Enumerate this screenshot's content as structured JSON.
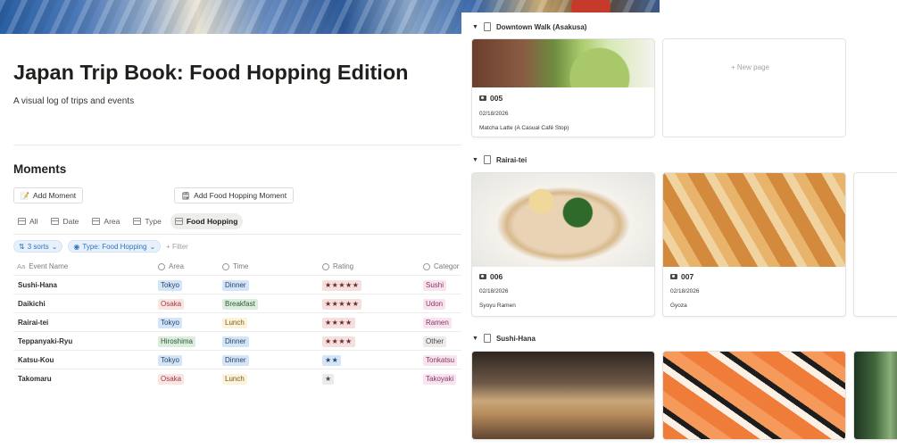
{
  "page": {
    "title": "Japan Trip Book: Food Hopping Edition",
    "description": "A visual log of trips and events",
    "section_title": "Moments"
  },
  "buttons": {
    "add_moment": "Add Moment",
    "add_food_moment": "Add Food Hopping Moment"
  },
  "tabs": [
    {
      "label": "All",
      "active": false
    },
    {
      "label": "Date",
      "active": false
    },
    {
      "label": "Area",
      "active": false
    },
    {
      "label": "Type",
      "active": false
    },
    {
      "label": "Food Hopping",
      "active": true
    }
  ],
  "filters": {
    "sorts": "3 sorts",
    "type_filter": "Type: Food Hopping",
    "add_filter": "+ Filter"
  },
  "table": {
    "columns": [
      "Event Name",
      "Area",
      "Time",
      "Rating",
      "Categor"
    ],
    "rows": [
      {
        "name": "Sushi-Hana",
        "area": "Tokyo",
        "time": "Dinner",
        "rating": "★★★★★",
        "category": "Sushi"
      },
      {
        "name": "Daikichi",
        "area": "Osaka",
        "time": "Breakfast",
        "rating": "★★★★★",
        "category": "Udon"
      },
      {
        "name": "Rairai-tei",
        "area": "Tokyo",
        "time": "Lunch",
        "rating": "★★★★",
        "category": "Ramen"
      },
      {
        "name": "Teppanyaki-Ryu",
        "area": "Hiroshima",
        "time": "Dinner",
        "rating": "★★★★",
        "category": "Other"
      },
      {
        "name": "Katsu-Kou",
        "area": "Tokyo",
        "time": "Dinner",
        "rating": "★★",
        "category": "Tonkatsu"
      },
      {
        "name": "Takomaru",
        "area": "Osaka",
        "time": "Lunch",
        "rating": "★",
        "category": "Takoyaki"
      }
    ]
  },
  "board": {
    "groups": [
      {
        "label": "Downtown Walk (Asakusa)"
      },
      {
        "label": "Rairai-tei"
      },
      {
        "label": "Sushi-Hana"
      }
    ],
    "new_page": "+ New page",
    "cards": [
      {
        "id": "005",
        "date": "02/18/2026",
        "desc": "Matcha Latte (A Casual Café Stop)"
      },
      {
        "id": "006",
        "date": "02/18/2026",
        "desc": "Syoyu Ramen"
      },
      {
        "id": "007",
        "date": "02/18/2026",
        "desc": "Gyoza"
      }
    ]
  },
  "colors": {
    "accent_blue": "#2f73c4",
    "tag_blue": "#d3e5f7",
    "tag_red": "#fbe4e4",
    "tag_green": "#dbeddb",
    "tag_yellow": "#fbf3db",
    "tag_pink": "#f8e4ef"
  }
}
